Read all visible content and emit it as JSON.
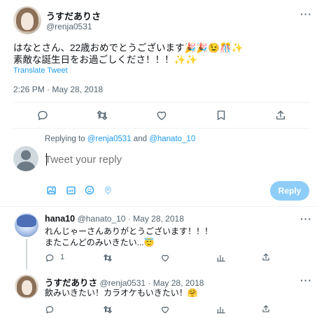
{
  "main_tweet": {
    "display_name": "うすだありさ",
    "handle": "@renja0531",
    "text_line1": "はなとさん、22歳おめでとうございます🎉🎉😉🎊✨",
    "text_line2": "素敵な誕生日をお過ごしくださ！！！✨✨",
    "translate_label": "Translate Tweet",
    "timestamp": "2:26 PM · May 28, 2018"
  },
  "actions": {
    "icons": [
      "reply-icon",
      "retweet-icon",
      "like-icon",
      "bookmark-icon",
      "share-icon"
    ]
  },
  "reply_box": {
    "replying_prefix": "Replying to",
    "replying_user1": "@renja0531",
    "replying_and": "and",
    "replying_user2": "@hanato_10",
    "placeholder": "Tweet your reply",
    "reply_button": "Reply",
    "toolbar_icons": [
      "image-icon",
      "gif-icon",
      "emoji-icon",
      "location-icon"
    ]
  },
  "replies": [
    {
      "display_name": "hana10",
      "handle_and_date": "@hanato_10 · May 28, 2018",
      "text_line1": "れんじゃーさんありがとうございます！！！",
      "text_line2": "またこんどのみいきたい...😇",
      "reply_count": "1"
    },
    {
      "display_name": "うすだありさ",
      "handle_and_date": "@renja0531 · May 28, 2018",
      "text_line1": "飲みいきたい！カラオケもいきたい！🤗"
    }
  ],
  "colors": {
    "accent": "#1d9bf0",
    "reply_button_disabled": "#8ecdf8",
    "secondary_text": "#536471",
    "divider": "#eff3f4"
  }
}
